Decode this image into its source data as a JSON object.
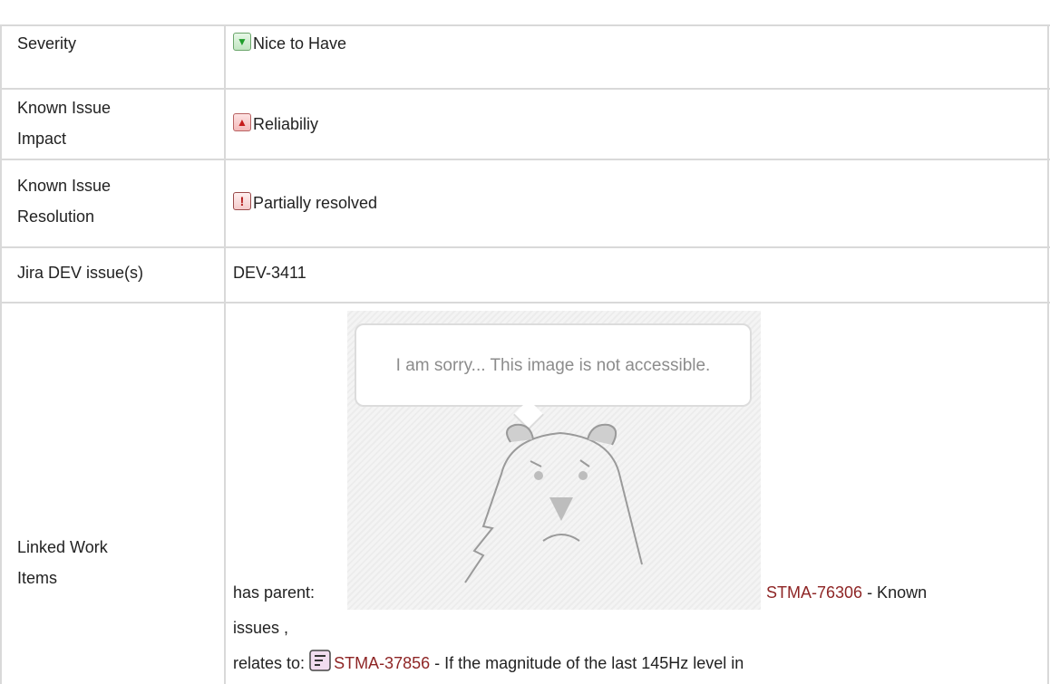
{
  "rows": [
    {
      "label": "Severity",
      "value": "Nice to Have",
      "icon": "green-down-arrow-icon"
    },
    {
      "label_lines": [
        "Known Issue",
        "Impact"
      ],
      "value": "Reliabiliy",
      "icon": "red-up-arrow-icon"
    },
    {
      "label_lines": [
        "Known Issue",
        "Resolution"
      ],
      "value": "Partially resolved",
      "icon": "exclamation-icon"
    },
    {
      "label": "Jira DEV issue(s)",
      "value": "DEV-3411"
    },
    {
      "label_lines": [
        "Linked Work",
        "Items"
      ],
      "image_placeholder": {
        "text": "I am sorry... This image is not accessible.",
        "icon": "sad-bear-icon"
      },
      "parent_prefix": "has parent:",
      "parent_link": "STMA-76306",
      "parent_suffix": " - Known",
      "parent_suffix2": "issues ,",
      "relates_prefix": "relates to:",
      "relates_icon": "story-icon",
      "relates_link": "STMA-37856",
      "relates_suffix": " - If the magnitude of the last 145Hz level in"
    }
  ],
  "colors": {
    "border": "#d9d9d9",
    "link": "#8e2525",
    "text": "#222222"
  }
}
